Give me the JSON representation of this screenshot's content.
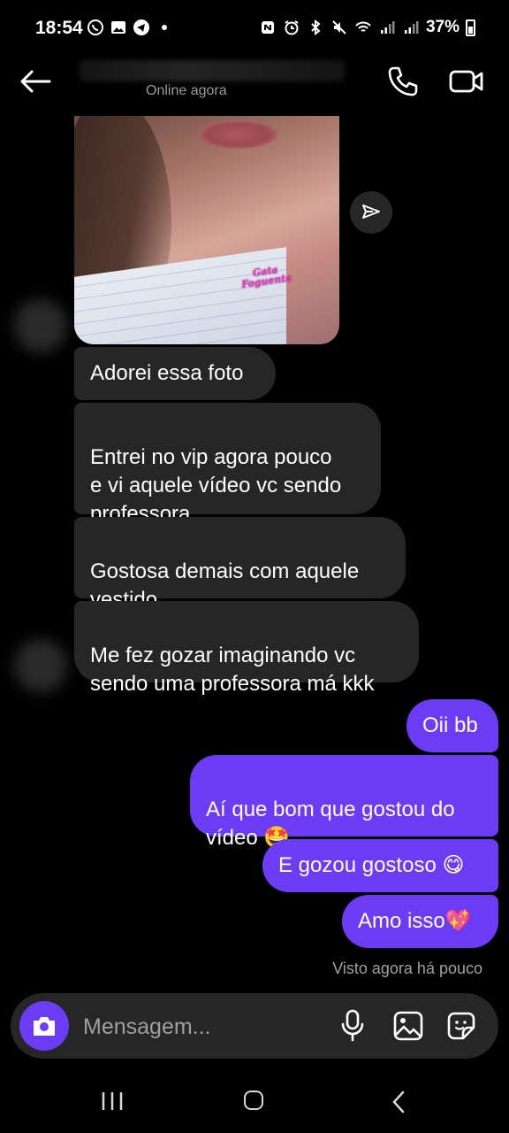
{
  "status_bar": {
    "time": "18:54",
    "battery": "37%",
    "left_icons": [
      "whatsapp-icon",
      "gallery-icon",
      "telegram-icon",
      "dot-icon"
    ],
    "right_icons": [
      "nfc-icon",
      "alarm-icon",
      "bluetooth-icon",
      "mute-icon",
      "wifi-icon",
      "signal-icon",
      "signal-icon",
      "battery-icon"
    ]
  },
  "header": {
    "online_status": "Online agora",
    "icons": [
      "back-arrow-icon",
      "phone-icon",
      "video-camera-icon"
    ]
  },
  "photo": {
    "watermark": "Gata Foguenta"
  },
  "messages": {
    "received": [
      {
        "text": "Adorei essa foto"
      },
      {
        "text": "Entrei no vip agora pouco\ne vi aquele vídeo vc sendo\nprofessora"
      },
      {
        "text": "Gostosa demais com aquele\nvestido"
      },
      {
        "text": "Me fez gozar imaginando vc\nsendo uma professora má kkk"
      }
    ],
    "sent": [
      {
        "text": "Oii bb"
      },
      {
        "text": "Aí que bom que gostou do\nvídeo 🤩"
      },
      {
        "text": "E gozou gostoso 😋"
      },
      {
        "text": "Amo isso💖"
      }
    ]
  },
  "seen_label": "Visto agora há pouco",
  "composer": {
    "placeholder": "Mensagem...",
    "icons": [
      "camera-icon",
      "microphone-icon",
      "image-icon",
      "sticker-icon"
    ]
  },
  "colors": {
    "background": "#000000",
    "received_bubble": "#262626",
    "sent_bubble": "#6c3cf5",
    "composer": "#262626"
  }
}
